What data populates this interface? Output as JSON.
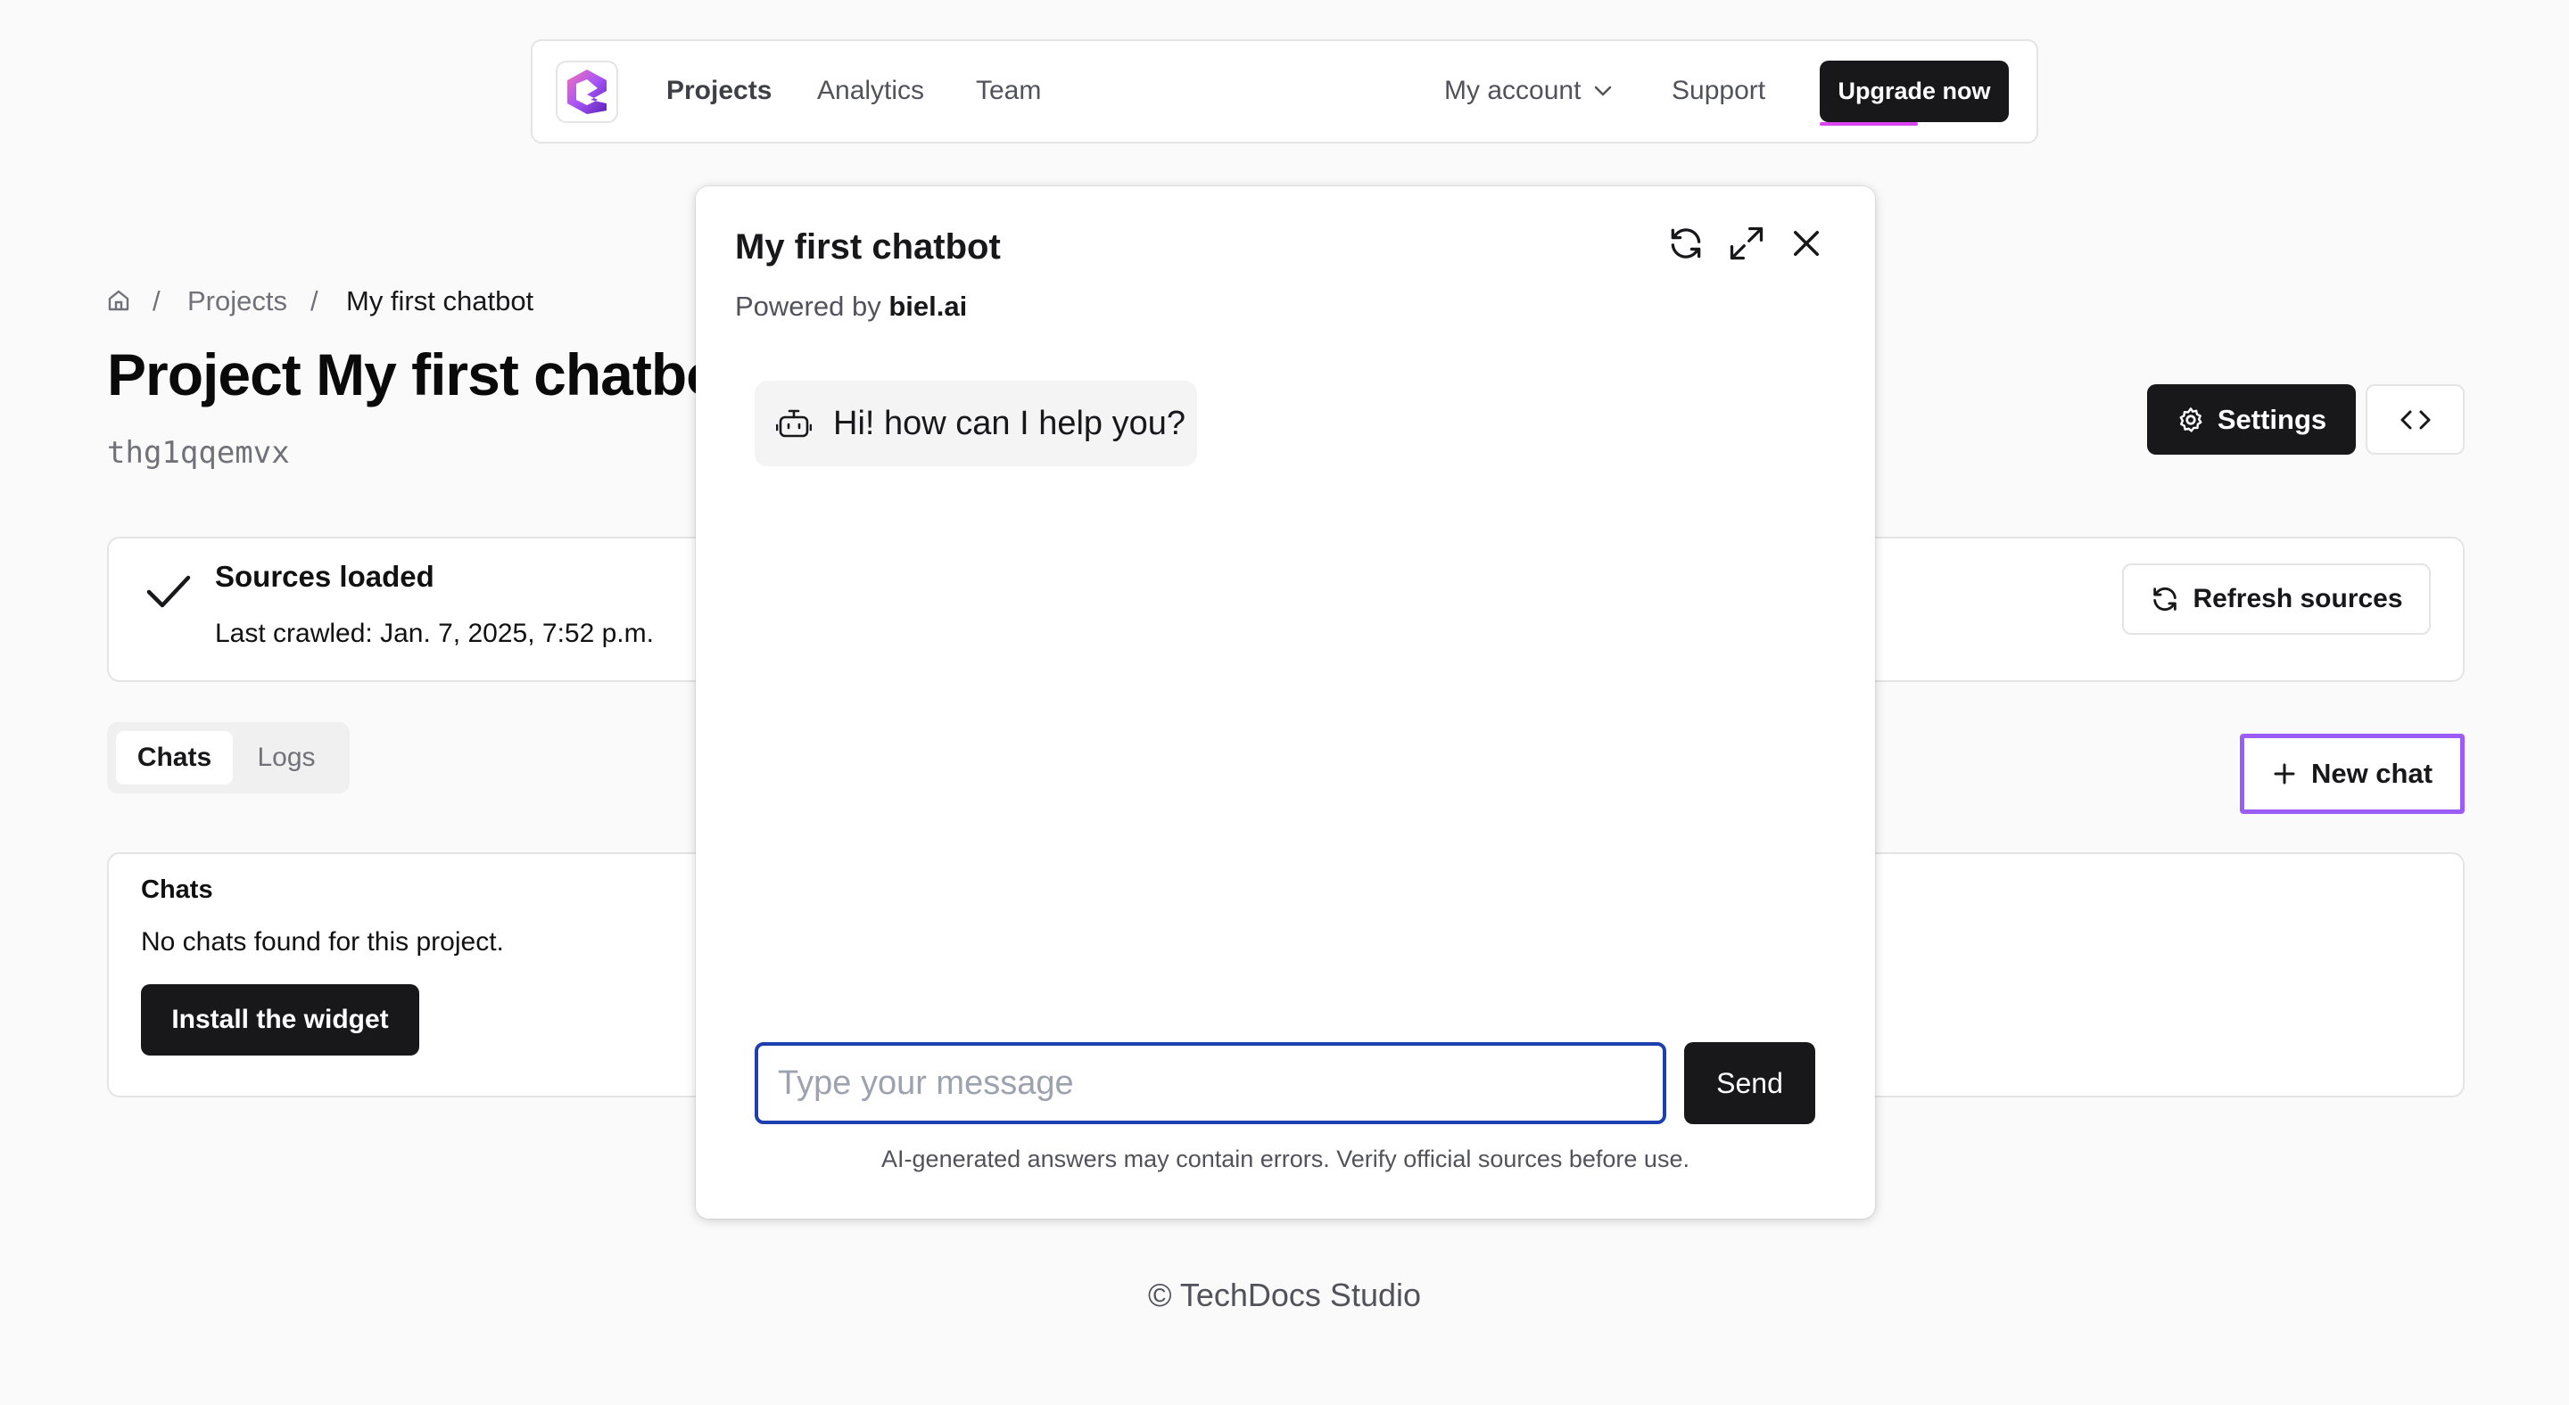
{
  "nav": {
    "links": [
      "Projects",
      "Analytics",
      "Team"
    ],
    "my_account": "My account",
    "support": "Support",
    "upgrade": "Upgrade now"
  },
  "breadcrumb": {
    "home_icon": "home-icon",
    "separator": "/",
    "projects": "Projects",
    "current": "My first chatbot"
  },
  "page": {
    "title": "Project My first chatbot",
    "project_id": "thg1qqemvx",
    "settings_button": "Settings",
    "embed_icon": "code-icon"
  },
  "sources": {
    "status": "Sources loaded",
    "last_crawled": "Last crawled: Jan. 7, 2025, 7:52 p.m.",
    "refresh_button": "Refresh sources"
  },
  "tabs": [
    "Chats",
    "Logs"
  ],
  "new_chat_button": "New chat",
  "chats_card": {
    "heading": "Chats",
    "empty_text": "No chats found for this project.",
    "install_button": "Install the widget"
  },
  "chat_widget": {
    "title": "My first chatbot",
    "powered_by_prefix": "Powered by",
    "powered_by_brand": "biel.ai",
    "greeting": "Hi! how can I help you?",
    "input_placeholder": "Type your message",
    "send_button": "Send",
    "disclaimer": "AI-generated answers may contain errors. Verify official sources before use."
  },
  "footer": "© TechDocs Studio",
  "colors": {
    "primary_dark": "#18181b",
    "highlight_border": "#9b5cf6",
    "input_focus": "#1e40af",
    "upgrade_glow": "#d946ef"
  }
}
